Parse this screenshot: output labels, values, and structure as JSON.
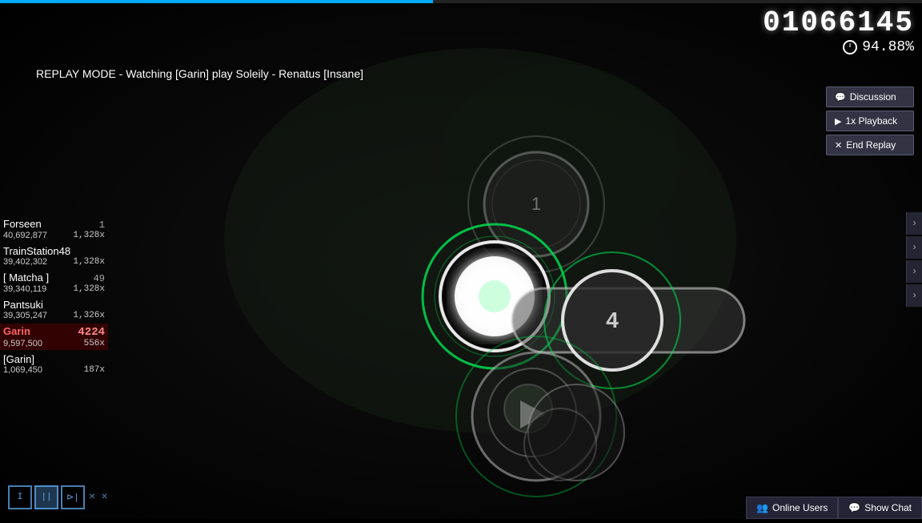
{
  "progress": {
    "fill_percent": "47%"
  },
  "score": {
    "number": "01066145",
    "accuracy": "94.88%"
  },
  "replay_mode": {
    "text": "REPLAY MODE - Watching [Garin] play Soleily - Renatus [Insane]"
  },
  "buttons": {
    "discussion": "Discussion",
    "playback": "1x Playback",
    "end_replay": "End Replay"
  },
  "scoreboard": [
    {
      "name": "Forseen",
      "rank": "1",
      "score": "40,692,877",
      "combo": "1,328x",
      "highlighted": false
    },
    {
      "name": "TrainStation48",
      "rank": "",
      "score": "39,402,302",
      "combo": "1,328x",
      "highlighted": false
    },
    {
      "name": "[ Matcha ]",
      "rank": "49",
      "score": "39,340,119",
      "combo": "1,328x",
      "highlighted": false
    },
    {
      "name": "Pantsuki",
      "rank": "",
      "score": "39,305,247",
      "combo": "1,326x",
      "highlighted": false
    },
    {
      "name": "Garin",
      "rank": "4224",
      "score": "9,597,500",
      "combo": "556x",
      "highlighted": true
    },
    {
      "name": "[Garin]",
      "rank": "",
      "score": "1,069,450",
      "combo": "187x",
      "highlighted": false
    }
  ],
  "key_hud": {
    "keys": [
      "I",
      "||",
      ">|",
      "X",
      "X"
    ]
  },
  "bottom": {
    "online_users": "Online Users",
    "show_chat": "Show Chat"
  },
  "chevrons": [
    "›",
    "›",
    "›",
    "›"
  ]
}
